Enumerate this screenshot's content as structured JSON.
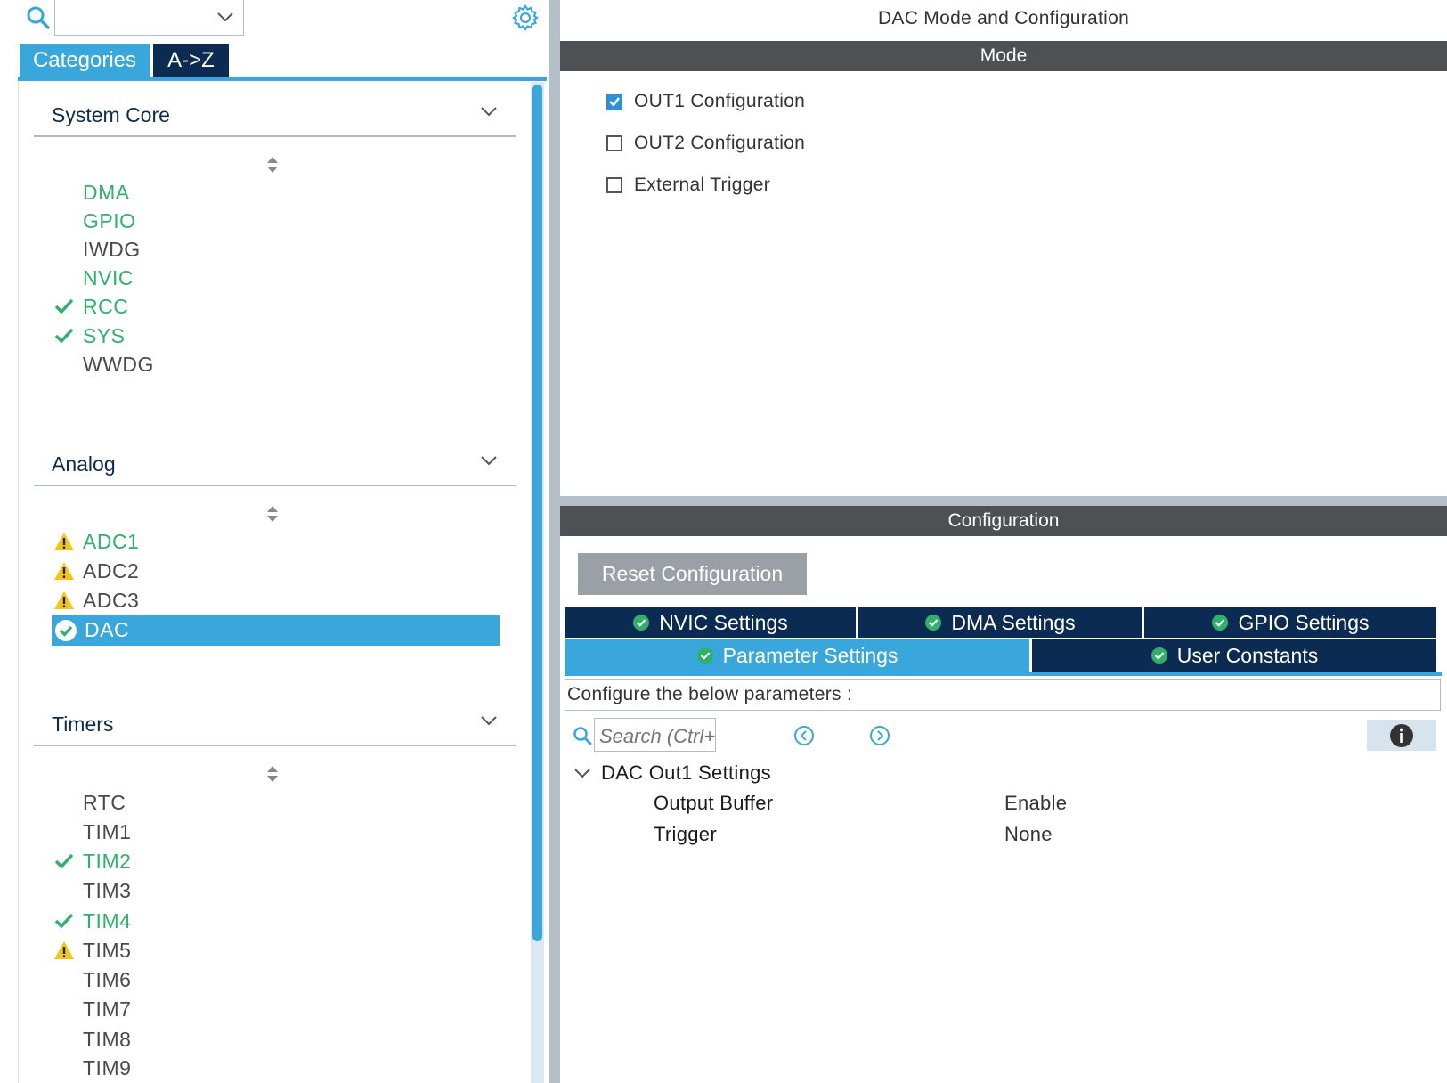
{
  "left": {
    "search": {
      "value": ""
    },
    "tabs": {
      "categories": "Categories",
      "az": "A->Z"
    },
    "categories": [
      {
        "name": "System Core",
        "items": [
          {
            "label": "DMA",
            "state": "green",
            "icon": "none"
          },
          {
            "label": "GPIO",
            "state": "green",
            "icon": "none"
          },
          {
            "label": "IWDG",
            "state": "grey",
            "icon": "none"
          },
          {
            "label": "NVIC",
            "state": "green",
            "icon": "none"
          },
          {
            "label": "RCC",
            "state": "green",
            "icon": "check-icon"
          },
          {
            "label": "SYS",
            "state": "green",
            "icon": "check-icon"
          },
          {
            "label": "WWDG",
            "state": "grey",
            "icon": "none"
          }
        ]
      },
      {
        "name": "Analog",
        "items": [
          {
            "label": "ADC1",
            "state": "green",
            "icon": "warning-icon"
          },
          {
            "label": "ADC2",
            "state": "grey",
            "icon": "warning-icon"
          },
          {
            "label": "ADC3",
            "state": "grey",
            "icon": "warning-icon"
          },
          {
            "label": "DAC",
            "state": "selected",
            "icon": "check-circle-icon"
          }
        ]
      },
      {
        "name": "Timers",
        "items": [
          {
            "label": "RTC",
            "state": "grey",
            "icon": "none"
          },
          {
            "label": "TIM1",
            "state": "grey",
            "icon": "none"
          },
          {
            "label": "TIM2",
            "state": "green",
            "icon": "check-icon"
          },
          {
            "label": "TIM3",
            "state": "grey",
            "icon": "none"
          },
          {
            "label": "TIM4",
            "state": "green",
            "icon": "check-icon"
          },
          {
            "label": "TIM5",
            "state": "grey",
            "icon": "warning-icon"
          },
          {
            "label": "TIM6",
            "state": "grey",
            "icon": "none"
          },
          {
            "label": "TIM7",
            "state": "grey",
            "icon": "none"
          },
          {
            "label": "TIM8",
            "state": "grey",
            "icon": "none"
          },
          {
            "label": "TIM9",
            "state": "grey",
            "icon": "none"
          }
        ]
      }
    ]
  },
  "right": {
    "title": "DAC Mode and Configuration",
    "mode": {
      "header": "Mode",
      "options": [
        {
          "label": "OUT1 Configuration",
          "checked": true
        },
        {
          "label": "OUT2 Configuration",
          "checked": false
        },
        {
          "label": "External Trigger",
          "checked": false
        }
      ]
    },
    "config": {
      "header": "Configuration",
      "reset_label": "Reset Configuration",
      "tabs": {
        "nvic": "NVIC Settings",
        "dma": "DMA Settings",
        "gpio": "GPIO Settings",
        "parameter": "Parameter Settings",
        "user": "User Constants"
      },
      "hint": "Configure the below parameters :",
      "search_placeholder": "Search (Ctrl+F)",
      "group": "DAC Out1 Settings",
      "params": [
        {
          "name": "Output Buffer",
          "value": "Enable"
        },
        {
          "name": "Trigger",
          "value": "None"
        }
      ]
    }
  },
  "colors": {
    "accent": "#3aa7dc",
    "navy": "#0c2b52",
    "green": "#31b06b",
    "warning": "#f5c518",
    "section_bar": "#4d5154"
  }
}
